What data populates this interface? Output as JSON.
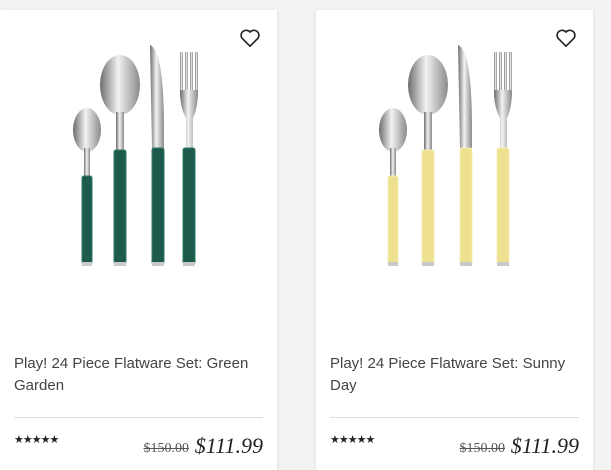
{
  "products": [
    {
      "title": "Play! 24 Piece Flatware Set: Green Garden",
      "rating": "★★★★★",
      "old_price": "$150.00",
      "price": "$111.99",
      "handle_color": "#1e5a4b",
      "handle_highlight": "#2f7a66",
      "wishlist_icon": "heart-outline-icon"
    },
    {
      "title": "Play! 24 Piece Flatware Set: Sunny Day",
      "rating": "★★★★★",
      "old_price": "$150.00",
      "price": "$111.99",
      "handle_color": "#ede08f",
      "handle_highlight": "#f7eeb3",
      "wishlist_icon": "heart-outline-icon"
    }
  ]
}
